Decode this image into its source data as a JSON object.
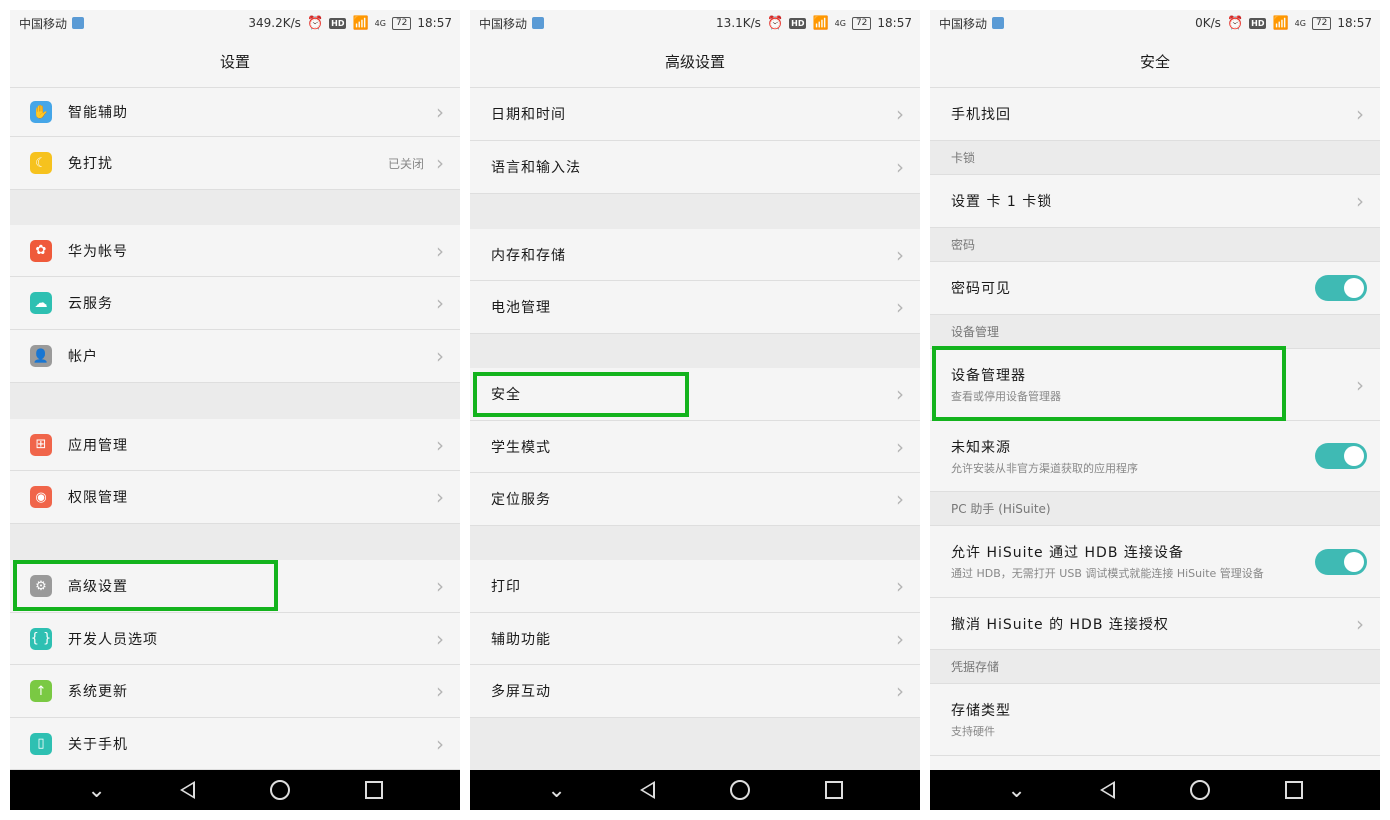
{
  "status": [
    {
      "carrier": "中国移动",
      "speed": "349.2K/s",
      "signal": "4G",
      "battery": "72",
      "time": "18:57"
    },
    {
      "carrier": "中国移动",
      "speed": "13.1K/s",
      "signal": "4G",
      "battery": "72",
      "time": "18:57"
    },
    {
      "carrier": "中国移动",
      "speed": "0K/s",
      "signal": "4G",
      "battery": "72",
      "time": "18:57"
    }
  ],
  "hd_label": "HD",
  "screen1": {
    "title": "设置",
    "items": [
      {
        "label": "智能辅助",
        "icon": "hand-icon",
        "color": "#45a6e8"
      },
      {
        "label": "免打扰",
        "icon": "moon-icon",
        "color": "#f6c21e",
        "value": "已关闭"
      },
      {
        "label": "华为帐号",
        "icon": "huawei-logo-icon",
        "color": "#ef5a3b"
      },
      {
        "label": "云服务",
        "icon": "cloud-icon",
        "color": "#2ec0b2"
      },
      {
        "label": "帐户",
        "icon": "person-icon",
        "color": "#9a9a9a"
      },
      {
        "label": "应用管理",
        "icon": "grid-icon",
        "color": "#f0654a"
      },
      {
        "label": "权限管理",
        "icon": "shield-icon",
        "color": "#f0654a"
      },
      {
        "label": "高级设置",
        "icon": "gear-icon",
        "color": "#9a9a9a"
      },
      {
        "label": "开发人员选项",
        "icon": "braces-icon",
        "color": "#2ec0b2"
      },
      {
        "label": "系统更新",
        "icon": "arrow-up-icon",
        "color": "#7ac943"
      },
      {
        "label": "关于手机",
        "icon": "phone-icon",
        "color": "#2ec0b2"
      }
    ]
  },
  "screen2": {
    "title": "高级设置",
    "items": [
      {
        "label": "日期和时间"
      },
      {
        "label": "语言和输入法"
      },
      {
        "label": "内存和存储"
      },
      {
        "label": "电池管理"
      },
      {
        "label": "安全"
      },
      {
        "label": "学生模式"
      },
      {
        "label": "定位服务"
      },
      {
        "label": "打印"
      },
      {
        "label": "辅助功能"
      },
      {
        "label": "多屏互动"
      }
    ]
  },
  "screen3": {
    "title": "安全",
    "phone_find": "手机找回",
    "sec_card": "卡锁",
    "card_lock": "设置 卡 1 卡锁",
    "sec_password": "密码",
    "password_visible": "密码可见",
    "sec_device": "设备管理",
    "device_admin": "设备管理器",
    "device_admin_sub": "查看或停用设备管理器",
    "unknown_sources": "未知来源",
    "unknown_sources_sub": "允许安装从非官方渠道获取的应用程序",
    "sec_pc": "PC 助手 (HiSuite)",
    "allow_hisuite": "允许 HiSuite 通过 HDB 连接设备",
    "allow_hisuite_sub": "通过 HDB，无需打开 USB 调试模式就能连接 HiSuite 管理设备",
    "revoke_hisuite": "撤消 HiSuite 的 HDB 连接授权",
    "sec_credential": "凭据存储",
    "storage_type": "存储类型",
    "storage_type_sub": "支持硬件"
  },
  "colors": {
    "highlight": "#13b31d",
    "toggle_on": "#3fbab4"
  }
}
